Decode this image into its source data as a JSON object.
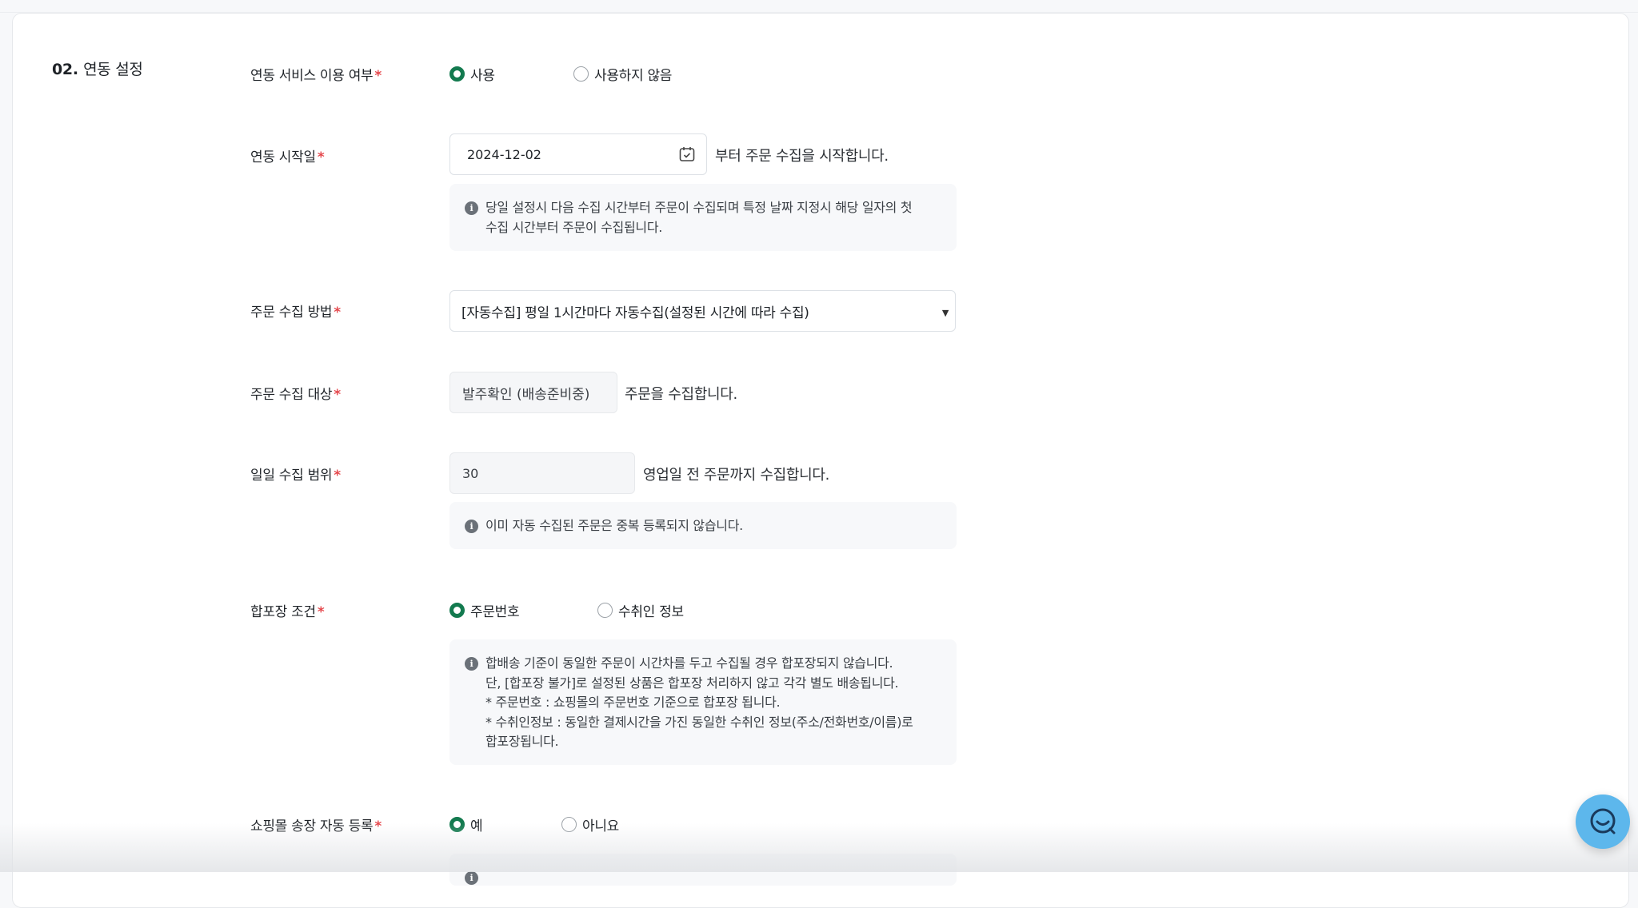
{
  "section": {
    "number": "02.",
    "name": "연동 설정"
  },
  "required_mark": "*",
  "fields": {
    "service_use": {
      "label": "연동 서비스 이용 여부",
      "options": [
        "사용",
        "사용하지 않음"
      ],
      "selected": "사용"
    },
    "start_date": {
      "label": "연동 시작일",
      "value": "2024-12-02",
      "suffix": "부터 주문 수집을 시작합니다.",
      "info": "당일 설정시 다음 수집 시간부터 주문이 수집되며 특정 날짜 지정시 해당 일자의 첫\n수집 시간부터 주문이 수집됩니다."
    },
    "collect_method": {
      "label": "주문 수집 방법",
      "value": "[자동수집] 평일 1시간마다 자동수집(설정된 시간에 따라 수집)"
    },
    "collect_target": {
      "label": "주문 수집 대상",
      "value": "발주확인 (배송준비중)",
      "suffix": "주문을 수집합니다."
    },
    "daily_range": {
      "label": "일일 수집 범위",
      "value": "30",
      "suffix": "영업일 전 주문까지 수집합니다.",
      "info": "이미 자동 수집된 주문은 중복 등록되지 않습니다."
    },
    "combine_condition": {
      "label": "합포장 조건",
      "options": [
        "주문번호",
        "수취인 정보"
      ],
      "selected": "주문번호",
      "info": "합배송 기준이 동일한 주문이 시간차를 두고 수집될 경우 합포장되지 않습니다.\n단, [합포장 불가]로 설정된 상품은 합포장 처리하지 않고 각각 별도 배송됩니다.\n* 주문번호 : 쇼핑몰의 주문번호 기준으로 합포장 됩니다.\n* 수취인정보 : 동일한 결제시간을 가진 동일한 수취인 정보(주소/전화번호/이름)로\n합포장됩니다."
    },
    "auto_invoice": {
      "label": "쇼핑몰 송장 자동 등록",
      "options": [
        "예",
        "아니요"
      ],
      "selected": "예"
    }
  },
  "colors": {
    "accent": "#137a4f",
    "required": "#e5484d",
    "chat": "#5db7ec"
  },
  "icons": {
    "calendar": "calendar-icon",
    "info": "info-icon",
    "chat": "chat-icon",
    "dropdown": "caret-down-icon"
  }
}
